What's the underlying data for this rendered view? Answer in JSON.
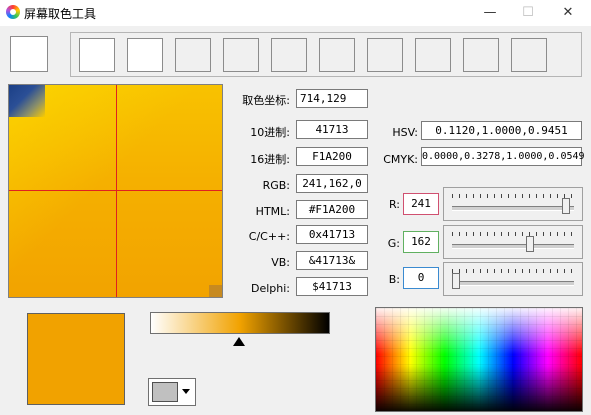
{
  "window": {
    "title": "屏幕取色工具",
    "minimize_glyph": "—",
    "maximize_glyph": "☐",
    "close_glyph": "✕"
  },
  "fields": {
    "coord": {
      "label": "取色坐标:",
      "value": "714,129"
    },
    "dec": {
      "label": "10进制:",
      "value": "41713"
    },
    "hex": {
      "label": "16进制:",
      "value": "F1A200"
    },
    "rgb": {
      "label": "RGB:",
      "value": "241,162,0"
    },
    "html": {
      "label": "HTML:",
      "value": "#F1A200"
    },
    "cpp": {
      "label": "C/C++:",
      "value": "0x41713"
    },
    "vb": {
      "label": "VB:",
      "value": "&41713&"
    },
    "delphi": {
      "label": "Delphi:",
      "value": "$41713"
    },
    "hsv": {
      "label": "HSV:",
      "value": "0.1120,1.0000,0.9451"
    },
    "cmyk": {
      "label": "CMYK:",
      "value": "0.0000,0.3278,1.0000,0.0549"
    }
  },
  "channels": {
    "r": {
      "label": "R:",
      "value": "241",
      "level": 0.945
    },
    "g": {
      "label": "G:",
      "value": "162",
      "level": 0.635
    },
    "b": {
      "label": "B:",
      "value": "0",
      "level": 0.0
    }
  },
  "colors": {
    "picked": "#F1A200",
    "r_border": "#d05070",
    "g_border": "#60b060",
    "b_border": "#3a8ad0",
    "crosshair": "#e02020"
  },
  "gradient_marker_level": 0.5
}
